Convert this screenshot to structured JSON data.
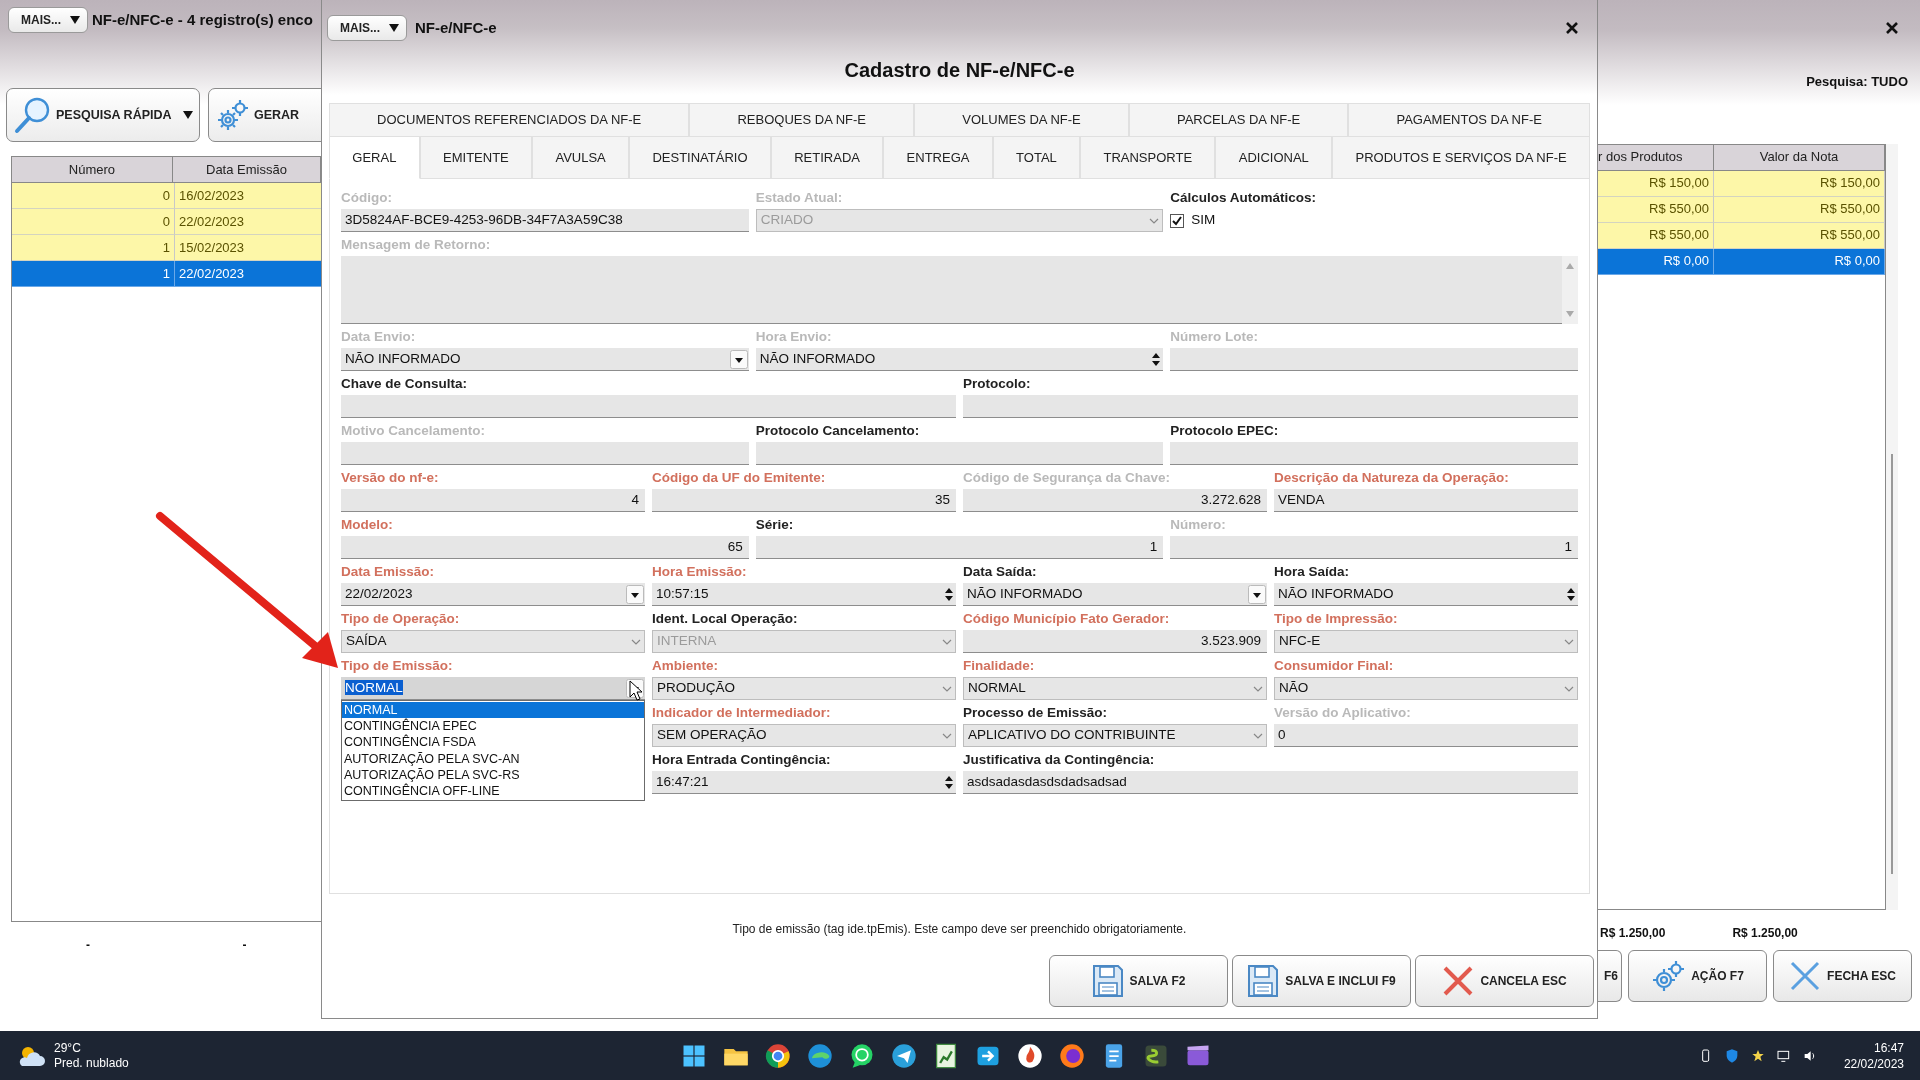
{
  "background": {
    "menu_button": "MAIS...",
    "title": "NF-e/NFC-e - 4 registro(s) enco",
    "search_scope": "Pesquisa: TUDO",
    "toolbar": [
      {
        "label": "PESQUISA RÁPIDA",
        "kind": "search",
        "caret": true
      },
      {
        "label": "GERAR",
        "kind": "gears",
        "caret": false
      }
    ],
    "table": {
      "columns_left": [
        "Número",
        "Data Emissão"
      ],
      "columns_right": [
        "r dos Produtos",
        "Valor da Nota"
      ],
      "rows": [
        {
          "numero": "0",
          "data": "16/02/2023",
          "produtos": "R$ 150,00",
          "nota": "R$ 150,00",
          "selected": false
        },
        {
          "numero": "0",
          "data": "22/02/2023",
          "produtos": "R$ 550,00",
          "nota": "R$ 550,00",
          "selected": false
        },
        {
          "numero": "1",
          "data": "15/02/2023",
          "produtos": "R$ 550,00",
          "nota": "R$ 550,00",
          "selected": false
        },
        {
          "numero": "1",
          "data": "22/02/2023",
          "produtos": "R$ 0,00",
          "nota": "R$ 0,00",
          "selected": true
        }
      ]
    },
    "totals_left": [
      "-",
      "-"
    ],
    "totals_right": [
      "R$ 1.250,00",
      "R$ 1.250,00"
    ],
    "buttons": [
      {
        "label": "F6",
        "kind": "plain"
      },
      {
        "label": "AÇÃO F7",
        "kind": "gear"
      },
      {
        "label": "FECHA ESC",
        "kind": "close"
      }
    ]
  },
  "dialog": {
    "menu_button": "MAIS...",
    "title": "NF-e/NFC-e",
    "heading": "Cadastro de NF-e/NFC-e",
    "tab_rows": [
      [
        {
          "label": "DOCUMENTOS REFERENCIADOS DA NF-E",
          "selected": false
        },
        {
          "label": "REBOQUES DA NF-E",
          "selected": false
        },
        {
          "label": "VOLUMES DA NF-E",
          "selected": false
        },
        {
          "label": "PARCELAS DA NF-E",
          "selected": false
        },
        {
          "label": "PAGAMENTOS DA NF-E",
          "selected": false
        }
      ],
      [
        {
          "label": "GERAL",
          "selected": true
        },
        {
          "label": "EMITENTE",
          "selected": false
        },
        {
          "label": "AVULSA",
          "selected": false
        },
        {
          "label": "DESTINATÁRIO",
          "selected": false
        },
        {
          "label": "RETIRADA",
          "selected": false
        },
        {
          "label": "ENTREGA",
          "selected": false
        },
        {
          "label": "TOTAL",
          "selected": false
        },
        {
          "label": "TRANSPORTE",
          "selected": false
        },
        {
          "label": "ADICIONAL",
          "selected": false
        },
        {
          "label": "PRODUTOS E SERVIÇOS DA NF-E",
          "selected": false
        }
      ]
    ],
    "form_rows": [
      [
        {
          "label": {
            "text": "Código:",
            "kind": "disabled"
          },
          "kind": "text",
          "value": "3D5824AF-BCE9-4253-96DB-34F7A3A59C38",
          "disabled": false
        },
        {
          "label": {
            "text": "Estado Atual:",
            "kind": "disabled"
          },
          "kind": "select",
          "value": "CRIADO",
          "disabled": true
        },
        {
          "label": {
            "text": "Cálculos Automáticos:",
            "kind": "normal"
          },
          "kind": "checkbox",
          "value": "SIM",
          "checked": true,
          "disabled": false
        }
      ],
      [
        {
          "label": {
            "text": "Mensagem de Retorno:",
            "kind": "disabled"
          },
          "kind": "textarea",
          "disabled": false
        }
      ],
      [
        {
          "label": {
            "text": "Data Envio:",
            "kind": "disabled"
          },
          "kind": "combo",
          "value": "NÃO INFORMADO",
          "disabled": false
        },
        {
          "label": {
            "text": "Hora Envio:",
            "kind": "disabled"
          },
          "kind": "spinner",
          "value": "NÃO INFORMADO",
          "disabled": false
        },
        {
          "label": {
            "text": "Número Lote:",
            "kind": "disabled"
          },
          "kind": "text",
          "disabled": false
        }
      ],
      [
        {
          "label": {
            "text": "Chave de Consulta:",
            "kind": "normal"
          },
          "kind": "text",
          "disabled": false
        },
        {
          "label": {
            "text": "Protocolo:",
            "kind": "normal"
          },
          "kind": "text",
          "disabled": false
        }
      ],
      [
        {
          "label": {
            "text": "Motivo Cancelamento:",
            "kind": "disabled"
          },
          "kind": "text",
          "disabled": false
        },
        {
          "label": {
            "text": "Protocolo Cancelamento:",
            "kind": "normal"
          },
          "kind": "text",
          "disabled": false
        },
        {
          "label": {
            "text": "Protocolo EPEC:",
            "kind": "normal"
          },
          "kind": "text",
          "disabled": false
        }
      ],
      [
        {
          "label": {
            "text": "Versão do nf-e:",
            "kind": "required"
          },
          "kind": "number",
          "value": "4",
          "disabled": false
        },
        {
          "label": {
            "text": "Código da UF do Emitente:",
            "kind": "required"
          },
          "kind": "number",
          "value": "35",
          "disabled": false
        },
        {
          "label": {
            "text": "Código de Segurança da Chave:",
            "kind": "disabled"
          },
          "kind": "number",
          "value": "3.272.628",
          "disabled": false
        },
        {
          "label": {
            "text": "Descrição da Natureza da Operação:",
            "kind": "required"
          },
          "kind": "text",
          "value": "VENDA",
          "disabled": false
        }
      ],
      [
        {
          "label": {
            "text": "Modelo:",
            "kind": "required"
          },
          "kind": "number",
          "value": "65",
          "disabled": false
        },
        {
          "label": {
            "text": "Série:",
            "kind": "normal"
          },
          "kind": "number",
          "value": "1",
          "disabled": false
        },
        {
          "label": {
            "text": "Número:",
            "kind": "disabled"
          },
          "kind": "number",
          "value": "1",
          "disabled": false
        }
      ],
      [
        {
          "label": {
            "text": "Data Emissão:",
            "kind": "required"
          },
          "kind": "combo",
          "value": "22/02/2023",
          "disabled": false
        },
        {
          "label": {
            "text": "Hora Emissão:",
            "kind": "required"
          },
          "kind": "spinner",
          "value": "10:57:15",
          "disabled": false
        },
        {
          "label": {
            "text": "Data Saída:",
            "kind": "normal"
          },
          "kind": "combo",
          "value": "NÃO INFORMADO",
          "disabled": false
        },
        {
          "label": {
            "text": "Hora Saída:",
            "kind": "normal"
          },
          "kind": "spinner",
          "value": "NÃO INFORMADO",
          "disabled": false
        }
      ],
      [
        {
          "label": {
            "text": "Tipo de Operação:",
            "kind": "required"
          },
          "kind": "select",
          "value": "SAÍDA",
          "disabled": false
        },
        {
          "label": {
            "text": "Ident. Local Operação:",
            "kind": "normal"
          },
          "kind": "select",
          "value": "INTERNA",
          "disabled": true
        },
        {
          "label": {
            "text": "Código Município Fato Gerador:",
            "kind": "required"
          },
          "kind": "number",
          "value": "3.523.909",
          "disabled": false
        },
        {
          "label": {
            "text": "Tipo de Impressão:",
            "kind": "required"
          },
          "kind": "select",
          "value": "NFC-E",
          "disabled": false
        }
      ],
      [
        {
          "label": {
            "text": "Tipo de Emissão:",
            "kind": "required"
          },
          "kind": "combo",
          "value": "NORMAL",
          "disabled": false,
          "options": [
            {
              "label": "NORMAL",
              "selected": true
            },
            {
              "label": "CONTINGÊNCIA EPEC",
              "selected": false
            },
            {
              "label": "CONTINGÊNCIA FSDA",
              "selected": false
            },
            {
              "label": "AUTORIZAÇÃO PELA SVC-AN",
              "selected": false
            },
            {
              "label": "AUTORIZAÇÃO PELA SVC-RS",
              "selected": false
            },
            {
              "label": "CONTINGÊNCIA OFF-LINE",
              "selected": false
            }
          ]
        },
        {
          "label": {
            "text": "Ambiente:",
            "kind": "required"
          },
          "kind": "select",
          "value": "PRODUÇÃO",
          "disabled": false
        },
        {
          "label": {
            "text": "Finalidade:",
            "kind": "required"
          },
          "kind": "select",
          "value": "NORMAL",
          "disabled": false
        },
        {
          "label": {
            "text": "Consumidor Final:",
            "kind": "required"
          },
          "kind": "select",
          "value": "NÃO",
          "disabled": false
        }
      ],
      [
        {
          "label": {
            "text": "Indicador de Intermediador:",
            "kind": "required"
          },
          "kind": "select",
          "value": "SEM OPERAÇÃO",
          "disabled": false
        },
        {
          "label": {
            "text": "Processo de Emissão:",
            "kind": "normal"
          },
          "kind": "select",
          "value": "APLICATIVO DO CONTRIBUINTE",
          "disabled": false
        },
        {
          "label": {
            "text": "Versão do Aplicativo:",
            "kind": "disabled"
          },
          "kind": "text",
          "value": "0",
          "disabled": false
        }
      ],
      [
        {
          "label": {
            "text": "Hora Entrada Contingência:",
            "kind": "normal"
          },
          "kind": "spinner",
          "value": "16:47:21",
          "disabled": false
        },
        {
          "label": {
            "text": "Justificativa da Contingência:",
            "kind": "normal"
          },
          "kind": "text",
          "value": "asdsadasdasdsdadsadsad",
          "disabled": false
        }
      ]
    ],
    "hint": "Tipo de emissão (tag ide.tpEmis). Este campo deve ser preenchido obrigatoriamente.",
    "buttons": [
      {
        "label": "SALVA F2",
        "kind": "save"
      },
      {
        "label": "SALVA E INCLUI F9",
        "kind": "save"
      },
      {
        "label": "CANCELA ESC",
        "kind": "cancel"
      }
    ]
  },
  "taskbar": {
    "temperature": "29°C",
    "weather": "Pred. nublado",
    "time": "16:47",
    "date": "22/02/2023"
  }
}
